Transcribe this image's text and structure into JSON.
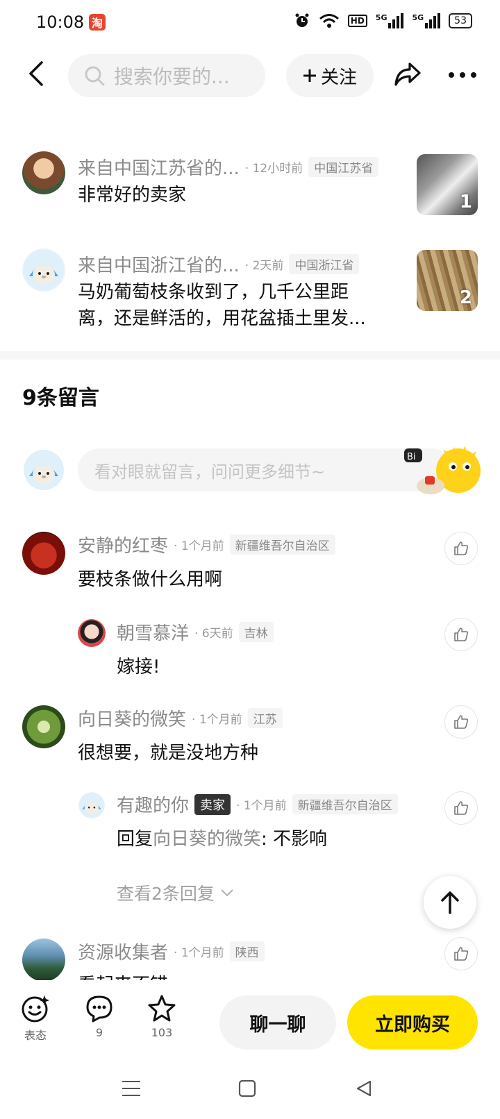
{
  "status_bar": {
    "time": "10:08",
    "app_badge": "淘",
    "network1": "5G",
    "network2": "5G",
    "hd": "HD",
    "battery": "53"
  },
  "header": {
    "search_placeholder": "搜索你要的...",
    "follow_label": "关注"
  },
  "reviews": [
    {
      "name": "来自中国江苏省的...",
      "time": "12小时前",
      "region": "中国江苏省",
      "text": "非常好的卖家",
      "photo_count": "1"
    },
    {
      "name": "来自中国浙江省的...",
      "time": "2天前",
      "region": "中国浙江省",
      "text_line1": "马奶葡萄枝条收到了，几千公里距",
      "text_line2": "离，还是鲜活的，用花盆插土里发...",
      "photo_count": "2"
    }
  ],
  "comments_section": {
    "title": "9条留言",
    "input_placeholder": "看对眼就留言，问问更多细节~"
  },
  "comments": [
    {
      "name": "安静的红枣",
      "time": "1个月前",
      "region": "新疆维吾尔自治区",
      "text": "要枝条做什么用啊"
    },
    {
      "name": "朝雪慕洋",
      "time": "6天前",
      "region": "吉林",
      "text": "嫁接!"
    },
    {
      "name": "向日葵的微笑",
      "time": "1个月前",
      "region": "江苏",
      "text": "很想要，就是没地方种"
    },
    {
      "name": "有趣的你",
      "badge": "卖家",
      "time": "1个月前",
      "region": "新疆维吾尔自治区",
      "reply_prefix": "回复",
      "reply_to": "向日葵的微笑",
      "reply_text": ": 不影响"
    },
    {
      "name": "资源收集者",
      "time": "1个月前",
      "region": "陕西",
      "text": "看起来不错"
    }
  ],
  "view_more": "查看2条回复",
  "bottom_bar": {
    "reaction_label": "表态",
    "comments_count": "9",
    "favorites_count": "103",
    "chat_label": "聊一聊",
    "buy_label": "立即购买"
  },
  "colors": {
    "accent_yellow": "#ffe400",
    "seller_badge": "#333333",
    "reply_link": "#8a8a8a"
  }
}
